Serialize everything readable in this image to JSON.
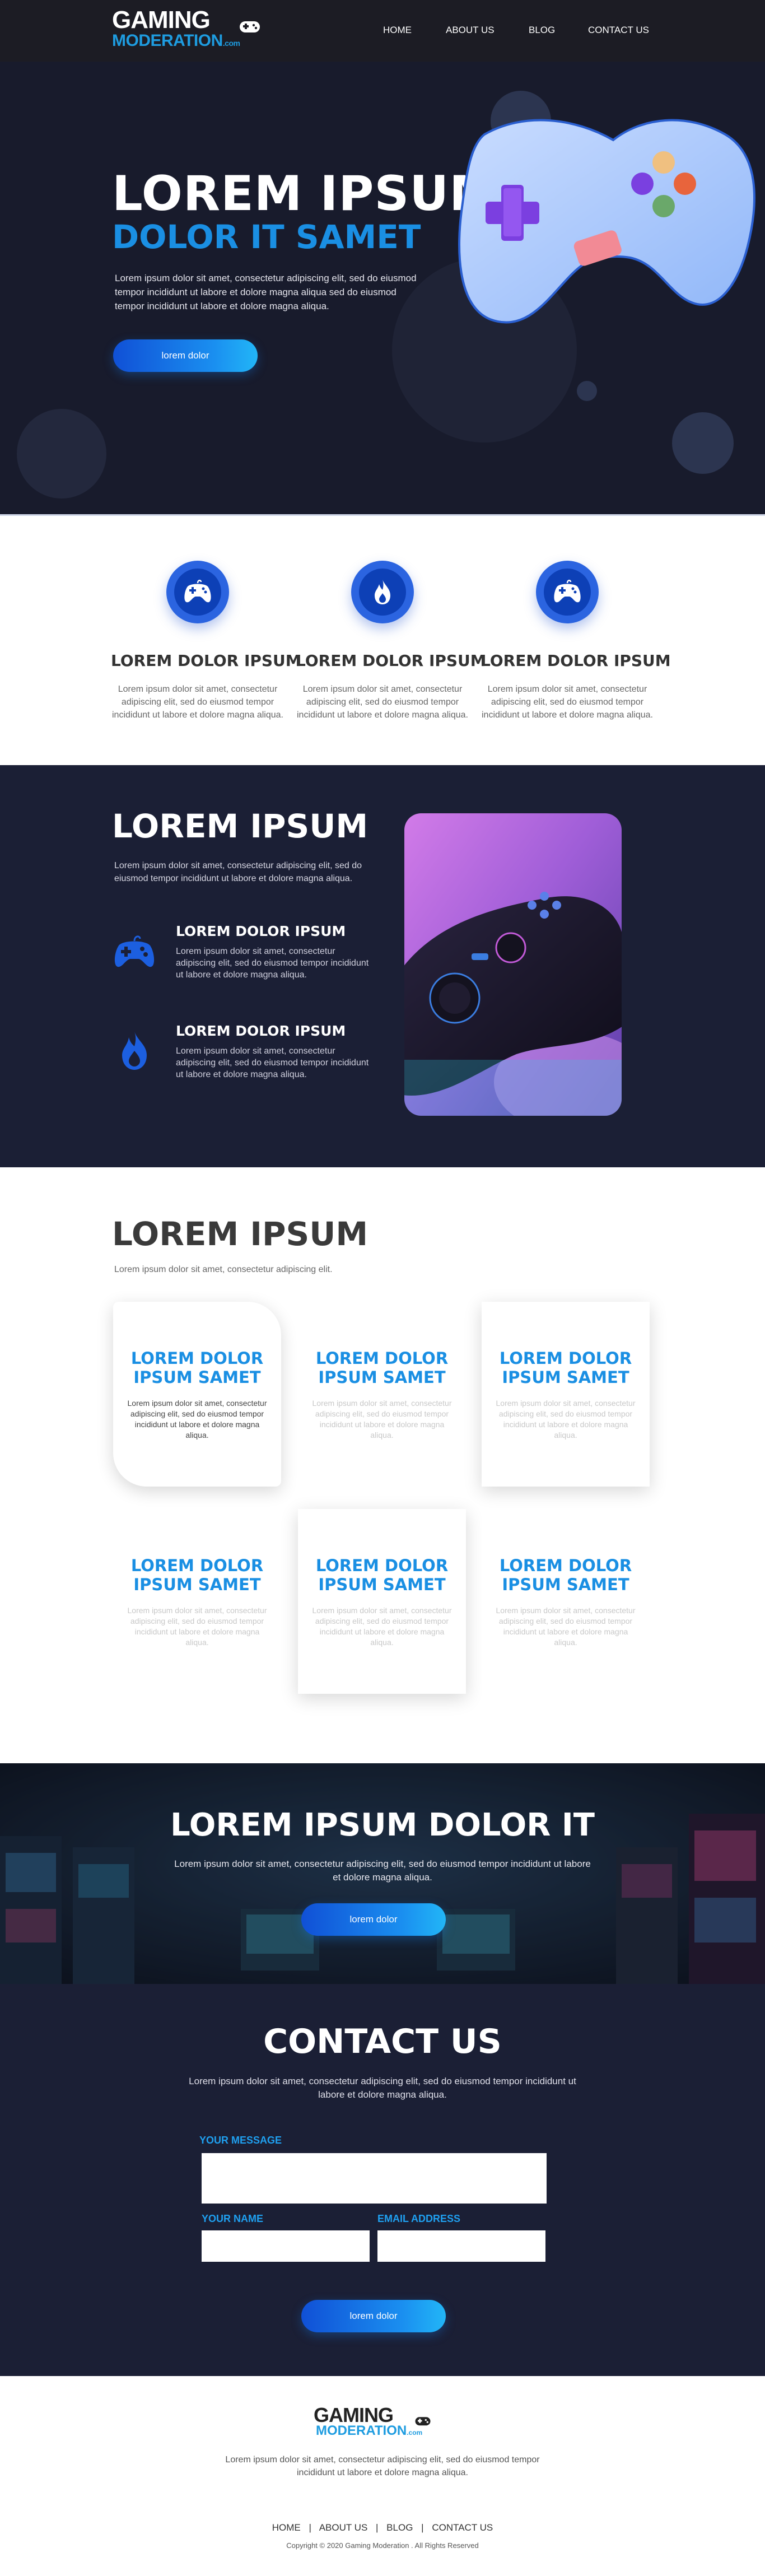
{
  "brand": {
    "line1": "GAMING",
    "line2": "MODERATION",
    "line2_suffix": ".com",
    "primary_color": "#1a8fe3",
    "dark_color": "#1b1f35"
  },
  "nav": {
    "items": [
      {
        "label": "HOME"
      },
      {
        "label": "ABOUT US"
      },
      {
        "label": "BLOG"
      },
      {
        "label": "CONTACT US"
      }
    ]
  },
  "hero": {
    "title": "LOREM IPSUM",
    "subtitle": "DOLOR IT SAMET",
    "text": "Lorem ipsum dolor sit amet, consectetur adipiscing elit, sed do eiusmod tempor incididunt ut labore et dolore magna aliqua sed do eiusmod tempor incididunt ut labore et dolore magna aliqua.",
    "button": "lorem dolor",
    "image_icon": "gamepad-illustration-icon"
  },
  "features": [
    {
      "icon": "gamepad-icon",
      "title": "LOREM DOLOR IPSUM",
      "text": "Lorem ipsum dolor sit amet, consectetur adipiscing elit, sed do eiusmod tempor incididunt ut labore et dolore magna aliqua."
    },
    {
      "icon": "flame-icon",
      "title": "LOREM DOLOR IPSUM",
      "text": "Lorem ipsum dolor sit amet, consectetur adipiscing elit, sed do eiusmod tempor incididunt ut labore et dolore magna aliqua."
    },
    {
      "icon": "gamepad-icon",
      "title": "LOREM DOLOR IPSUM",
      "text": "Lorem ipsum dolor sit amet, consectetur adipiscing elit, sed do eiusmod tempor incididunt ut labore et dolore magna aliqua."
    }
  ],
  "about": {
    "title": "LOREM IPSUM",
    "text": "Lorem ipsum dolor sit amet, consectetur adipiscing elit, sed do eiusmod tempor incididunt ut labore et dolore magna aliqua.",
    "items": [
      {
        "icon": "gamepad-icon",
        "title": "LOREM DOLOR IPSUM",
        "text": "Lorem ipsum dolor sit amet, consectetur adipiscing elit, sed do eiusmod tempor incididunt ut labore et dolore magna aliqua."
      },
      {
        "icon": "flame-icon",
        "title": "LOREM DOLOR IPSUM",
        "text": "Lorem ipsum dolor sit amet, consectetur adipiscing elit, sed do eiusmod tempor incididunt ut labore et dolore magna aliqua."
      }
    ],
    "photo_icon": "controller-photo"
  },
  "services": {
    "title": "LOREM IPSUM",
    "text": "Lorem ipsum dolor sit amet, consectetur adipiscing elit.",
    "cards": [
      {
        "title": "LOREM DOLOR IPSUM SAMET",
        "text": "Lorem ipsum dolor sit amet, consectetur adipiscing elit, sed do eiusmod tempor incididunt ut labore et dolore magna aliqua."
      },
      {
        "title": "LOREM DOLOR IPSUM SAMET",
        "text": "Lorem ipsum dolor sit amet, consectetur adipiscing elit, sed do eiusmod tempor incididunt ut labore et dolore magna aliqua."
      },
      {
        "title": "LOREM DOLOR IPSUM SAMET",
        "text": "Lorem ipsum dolor sit amet, consectetur adipiscing elit, sed do eiusmod tempor incididunt ut labore et dolore magna aliqua."
      },
      {
        "title": "LOREM DOLOR IPSUM SAMET",
        "text": "Lorem ipsum dolor sit amet, consectetur adipiscing elit, sed do eiusmod tempor incididunt ut labore et dolore magna aliqua."
      },
      {
        "title": "LOREM DOLOR IPSUM SAMET",
        "text": "Lorem ipsum dolor sit amet, consectetur adipiscing elit, sed do eiusmod tempor incididunt ut labore et dolore magna aliqua."
      },
      {
        "title": "LOREM DOLOR IPSUM SAMET",
        "text": "Lorem ipsum dolor sit amet, consectetur adipiscing elit, sed do eiusmod tempor incididunt ut labore et dolore magna aliqua."
      }
    ]
  },
  "cta": {
    "title": "LOREM IPSUM DOLOR IT",
    "text": "Lorem ipsum dolor sit amet, consectetur adipiscing elit, sed do eiusmod tempor incididunt ut labore et dolore magna aliqua.",
    "button": "lorem dolor",
    "bg_icon": "arcade-photo"
  },
  "contact": {
    "title": "CONTACT US",
    "text": "Lorem ipsum dolor sit amet, consectetur adipiscing elit, sed do eiusmod tempor incididunt ut labore et dolore magna aliqua.",
    "message_label": "YOUR MESSAGE",
    "name_label": "YOUR NAME",
    "email_label": "EMAIL ADDRESS",
    "message_value": "",
    "name_value": "",
    "email_value": "",
    "button": "lorem dolor"
  },
  "footer": {
    "text": "Lorem ipsum dolor sit amet, consectetur adipiscing elit, sed do eiusmod tempor incididunt ut labore et dolore magna aliqua.",
    "nav": [
      "HOME",
      "ABOUT US",
      "BLOG",
      "CONTACT US"
    ],
    "separator": "|",
    "copyright": "Copyright © 2020 Gaming Moderation . All Rights Reserved"
  }
}
